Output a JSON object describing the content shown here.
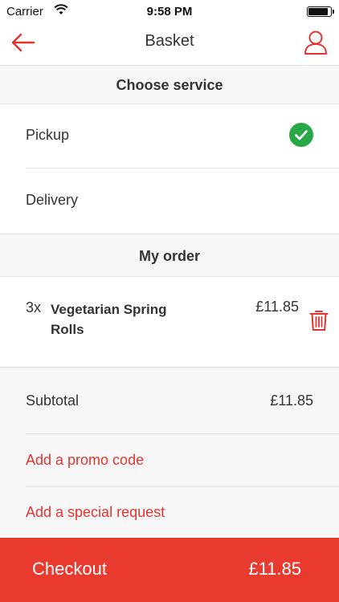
{
  "status_bar": {
    "carrier": "Carrier",
    "time": "9:58 PM",
    "battery_level": 0.95
  },
  "nav": {
    "title": "Basket",
    "back_icon": "arrow-left-icon",
    "profile_icon": "user-icon"
  },
  "service": {
    "header": "Choose service",
    "options": [
      {
        "label": "Pickup",
        "selected": true
      },
      {
        "label": "Delivery",
        "selected": false
      }
    ]
  },
  "order": {
    "header": "My order",
    "items": [
      {
        "qty": "3x",
        "name": "Vegetarian Spring Rolls",
        "price": "£11.85"
      }
    ]
  },
  "summary": {
    "subtotal_label": "Subtotal",
    "subtotal_value": "£11.85",
    "promo_link": "Add a promo code",
    "special_request_link": "Add a special request"
  },
  "checkout": {
    "label": "Checkout",
    "total": "£11.85"
  },
  "colors": {
    "accent": "#e93a30",
    "link": "#e3342f",
    "check_green": "#27a844",
    "section_bg": "#f7f7f7"
  }
}
